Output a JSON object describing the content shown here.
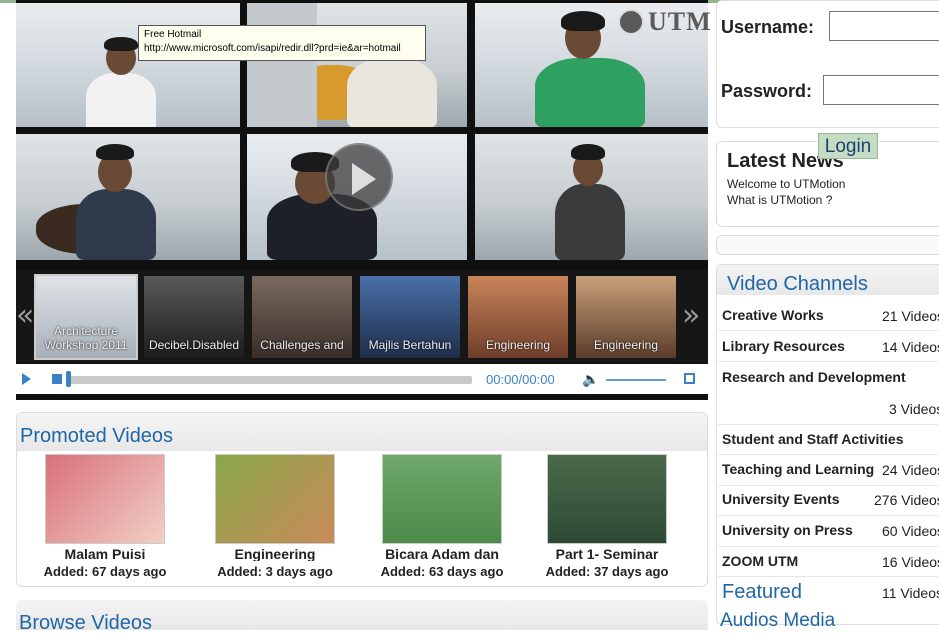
{
  "tooltip": {
    "title": "Free Hotmail",
    "url": "http://www.microsoft.com/isapi/redir.dll?prd=ie&ar=hotmail"
  },
  "player": {
    "logo_text": "UTM",
    "playlist": [
      {
        "label_line1": "Architecture",
        "label_line2": "Workshop 2011",
        "selected": true
      },
      {
        "label_line1": "",
        "label_line2": "Decibel.Disabled",
        "selected": false
      },
      {
        "label_line1": "",
        "label_line2": "Challenges and",
        "selected": false
      },
      {
        "label_line1": "",
        "label_line2": "Majlis Bertahun",
        "selected": false
      },
      {
        "label_line1": "",
        "label_line2": "Engineering",
        "selected": false
      },
      {
        "label_line1": "",
        "label_line2": "Engineering",
        "selected": false
      }
    ],
    "prev_arrow": "«",
    "next_arrow": "»",
    "time": "00:00/00:00",
    "progress": 0
  },
  "promoted": {
    "heading": "Promoted Videos",
    "items": [
      {
        "title": "Malam Puisi",
        "added": "Added: 67 days ago"
      },
      {
        "title": "Engineering",
        "added": "Added: 3 days ago"
      },
      {
        "title": "Bicara Adam dan",
        "added": "Added: 63 days ago"
      },
      {
        "title": "Part 1- Seminar",
        "added": "Added: 37 days ago"
      }
    ]
  },
  "browse": {
    "heading": "Browse Videos"
  },
  "login": {
    "username_label": "Username:",
    "password_label": "Password:",
    "button": "Login"
  },
  "news": {
    "heading": "Latest News",
    "items": [
      "Welcome to UTMotion",
      "What is UTMotion ?"
    ]
  },
  "channels": {
    "heading": "Video Channels",
    "items": [
      {
        "name": "Creative Works",
        "count": "21 Videos"
      },
      {
        "name": "Library Resources",
        "count": "14 Videos"
      },
      {
        "name": "Research and Development",
        "count": "3 Videos"
      },
      {
        "name": "Student and Staff Activities",
        "count": ""
      },
      {
        "name": "Teaching and Learning",
        "count": "24 Videos"
      },
      {
        "name": "University Events",
        "count": "276 Videos"
      },
      {
        "name": "University on Press",
        "count": "60 Videos"
      },
      {
        "name": "ZOOM UTM",
        "count": "16 Videos"
      },
      {
        "name": "",
        "count": "11 Videos"
      }
    ]
  },
  "featured": {
    "heading": "Featured"
  },
  "audios": {
    "heading": "Audios",
    "overlap_text": "Media"
  },
  "colors": {
    "accent": "#1f66a8",
    "player_blue": "#3a82c4",
    "login_green": "#c4dcc4"
  }
}
